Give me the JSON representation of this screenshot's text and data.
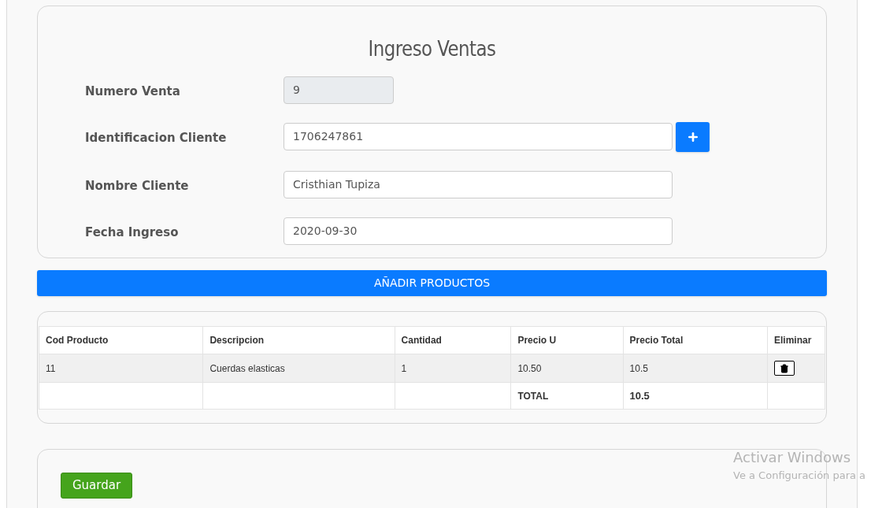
{
  "title": "Ingreso Ventas",
  "fields": [
    {
      "label": "Numero Venta",
      "value": "9",
      "disabled": true,
      "add_button": false
    },
    {
      "label": "Identificacion Cliente",
      "value": "1706247861",
      "disabled": false,
      "add_button": true
    },
    {
      "label": "Nombre Cliente",
      "value": "Cristhian Tupiza",
      "disabled": false,
      "add_button": false
    },
    {
      "label": "Fecha Ingreso",
      "value": "2020-09-30",
      "disabled": false,
      "add_button": false
    }
  ],
  "add_products_button": "AÑADIR PRODUCTOS",
  "table": {
    "columns": [
      "Cod Producto",
      "Descripcion",
      "Cantidad",
      "Precio U",
      "Precio Total",
      "Eliminar"
    ],
    "rows": [
      [
        "11",
        "Cuerdas elasticas",
        "1",
        "10.50",
        "10.5"
      ]
    ],
    "total_label": "TOTAL",
    "total_value": "10.5"
  },
  "save_button": "Guardar",
  "activation_notice": {
    "title": "Activar Windows",
    "subtitle": "Ve a Configuración para a"
  }
}
